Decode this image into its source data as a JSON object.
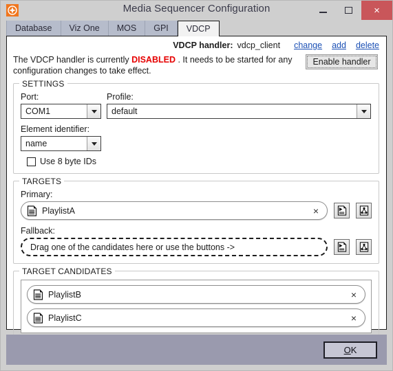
{
  "window": {
    "title": "Media Sequencer Configuration",
    "app_icon": "viz-compass-icon",
    "controls": {
      "minimize": "minimize-icon",
      "maximize": "maximize-icon",
      "close": "×"
    },
    "close_color": "#c9565a",
    "icon_color": "#f0761e"
  },
  "tabs": [
    {
      "label": "Database",
      "active": false
    },
    {
      "label": "Viz One",
      "active": false
    },
    {
      "label": "MOS",
      "active": false
    },
    {
      "label": "GPI",
      "active": false
    },
    {
      "label": "VDCP",
      "active": true
    }
  ],
  "handler": {
    "label": "VDCP handler:",
    "value": "vdcp_client",
    "links": [
      "change",
      "add",
      "delete"
    ],
    "link_color": "#1a4fb4"
  },
  "status": {
    "text_before": "The VDCP handler is currently ",
    "state": "DISABLED",
    "state_color": "#e60000",
    "text_after": " . It needs to be started for any configuration  changes to take effect.",
    "button_label": "Enable handler"
  },
  "settings": {
    "title": "SETTINGS",
    "port": {
      "label": "Port:",
      "value": "COM1"
    },
    "profile": {
      "label": "Profile:",
      "value": "default"
    },
    "element_identifier": {
      "label": "Element identifier:",
      "value": "name"
    },
    "use_8_byte_ids": {
      "label": "Use 8 byte IDs",
      "checked": false
    }
  },
  "targets": {
    "title": "TARGETS",
    "primary": {
      "label": "Primary:",
      "value": "PlaylistA",
      "icon": "document-icon",
      "close": "×",
      "buttons": [
        "pick-playlist-icon",
        "pick-target-group-icon"
      ]
    },
    "fallback": {
      "label": "Fallback:",
      "placeholder": "Drag one of the candidates here or use the buttons ->",
      "buttons": [
        "pick-playlist-icon",
        "pick-target-group-icon"
      ]
    }
  },
  "target_candidates": {
    "title": "TARGET CANDIDATES",
    "items": [
      {
        "label": "PlaylistB",
        "icon": "document-icon",
        "close": "×"
      },
      {
        "label": "PlaylistC",
        "icon": "document-icon",
        "close": "×"
      }
    ]
  },
  "footer": {
    "ok_mnemonic": "O",
    "ok_rest": "K",
    "bar_color": "#9a9aae"
  }
}
